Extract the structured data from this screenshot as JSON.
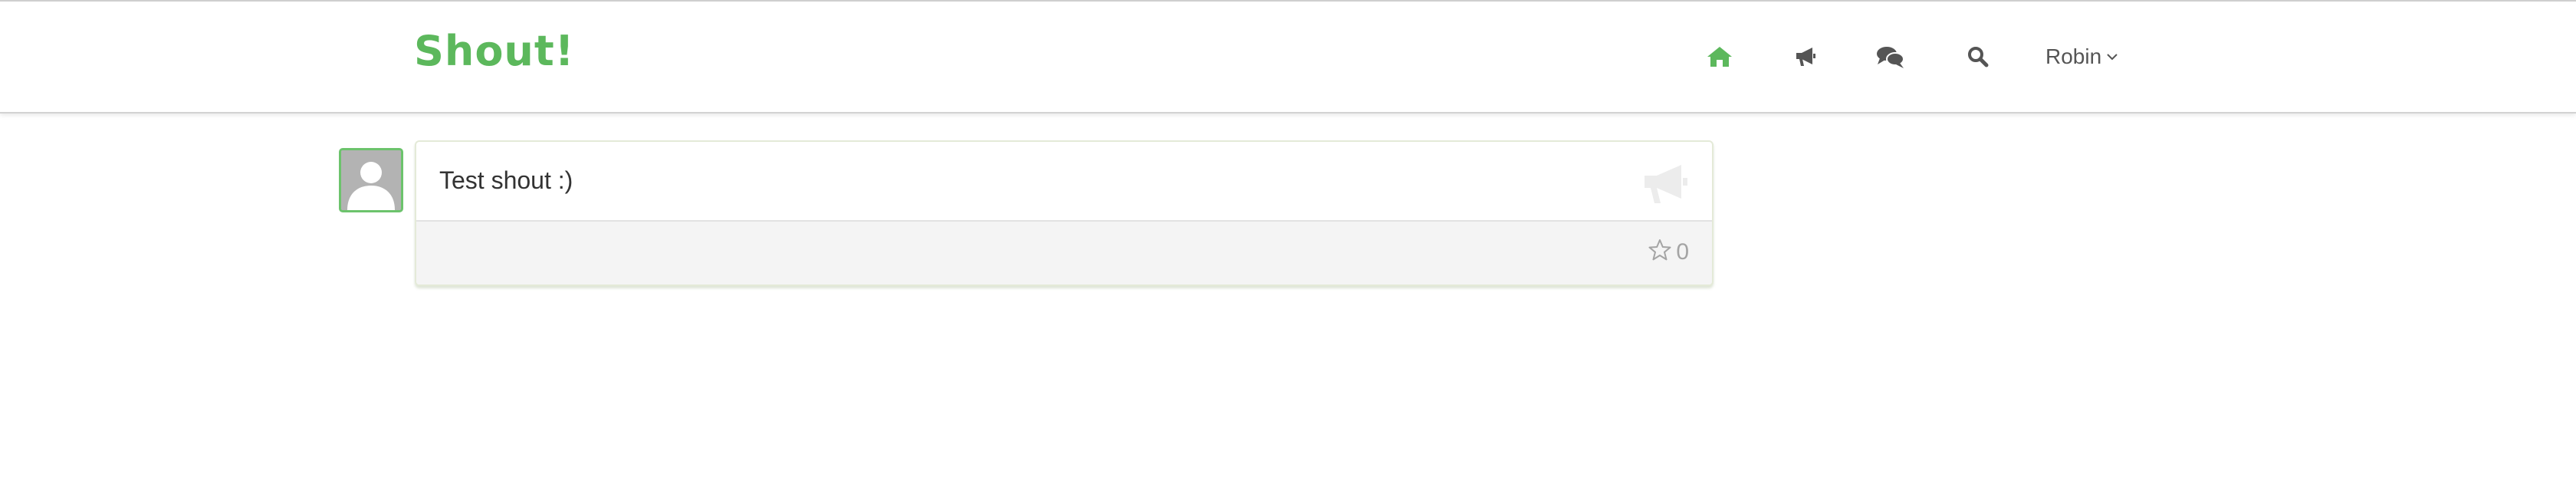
{
  "brand": {
    "logo_text": "Shout!",
    "color": "#5cb85c"
  },
  "nav": {
    "items": [
      {
        "icon": "home-icon",
        "active": true
      },
      {
        "icon": "bullhorn-icon",
        "active": false
      },
      {
        "icon": "comments-icon",
        "active": false
      },
      {
        "icon": "search-icon",
        "active": false
      }
    ],
    "user_label": "Robin",
    "user_menu_icon": "chevron-down-icon"
  },
  "feed": {
    "shouts": [
      {
        "text": "Test shout :)",
        "type_icon": "bullhorn-icon",
        "star_count": "0",
        "avatar_icon": "user-silhouette-icon"
      }
    ]
  },
  "colors": {
    "accent": "#5cb85c",
    "nav_icon": "#555555",
    "muted": "#a4a4a4"
  }
}
